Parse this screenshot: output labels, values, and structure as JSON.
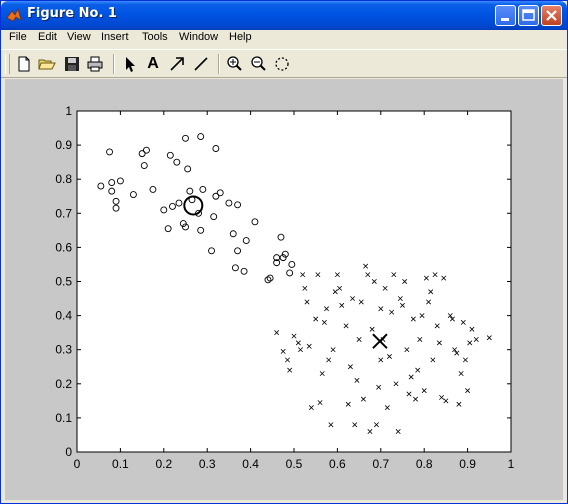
{
  "window": {
    "title": "Figure No. 1",
    "colors": {
      "titlebar": "#0054e3",
      "figure_bg": "#c8c8c8"
    }
  },
  "menu": [
    "File",
    "Edit",
    "View",
    "Insert",
    "Tools",
    "Window",
    "Help"
  ],
  "toolbar": {
    "tools": [
      "new-file-icon",
      "open-folder-icon",
      "save-icon",
      "print-icon",
      "pointer-arrow-icon",
      "text-a-icon",
      "draw-arrow-icon",
      "draw-line-icon",
      "zoom-in-icon",
      "zoom-out-icon",
      "rotate-3d-icon"
    ],
    "text_tool_glyph": "A"
  },
  "chart_data": {
    "type": "scatter",
    "title": "",
    "xlabel": "",
    "ylabel": "",
    "xlim": [
      0,
      1
    ],
    "ylim": [
      0,
      1
    ],
    "xticks": [
      "0",
      "0.1",
      "0.2",
      "0.3",
      "0.4",
      "0.5",
      "0.6",
      "0.7",
      "0.8",
      "0.9",
      "1"
    ],
    "yticks": [
      "0",
      "0.1",
      "0.2",
      "0.3",
      "0.4",
      "0.5",
      "0.6",
      "0.7",
      "0.8",
      "0.9",
      "1"
    ],
    "grid": false,
    "series": [
      {
        "marker": "o",
        "points": [
          [
            0.055,
            0.78
          ],
          [
            0.075,
            0.88
          ],
          [
            0.08,
            0.79
          ],
          [
            0.08,
            0.765
          ],
          [
            0.09,
            0.735
          ],
          [
            0.09,
            0.715
          ],
          [
            0.1,
            0.795
          ],
          [
            0.13,
            0.755
          ],
          [
            0.15,
            0.875
          ],
          [
            0.155,
            0.84
          ],
          [
            0.16,
            0.885
          ],
          [
            0.175,
            0.77
          ],
          [
            0.2,
            0.71
          ],
          [
            0.21,
            0.655
          ],
          [
            0.215,
            0.87
          ],
          [
            0.22,
            0.72
          ],
          [
            0.23,
            0.85
          ],
          [
            0.235,
            0.73
          ],
          [
            0.245,
            0.67
          ],
          [
            0.25,
            0.66
          ],
          [
            0.25,
            0.92
          ],
          [
            0.255,
            0.83
          ],
          [
            0.26,
            0.765
          ],
          [
            0.265,
            0.74
          ],
          [
            0.28,
            0.7
          ],
          [
            0.285,
            0.65
          ],
          [
            0.285,
            0.925
          ],
          [
            0.29,
            0.77
          ],
          [
            0.31,
            0.59
          ],
          [
            0.315,
            0.69
          ],
          [
            0.32,
            0.89
          ],
          [
            0.32,
            0.75
          ],
          [
            0.33,
            0.76
          ],
          [
            0.35,
            0.73
          ],
          [
            0.36,
            0.64
          ],
          [
            0.365,
            0.54
          ],
          [
            0.37,
            0.59
          ],
          [
            0.37,
            0.725
          ],
          [
            0.385,
            0.53
          ],
          [
            0.39,
            0.62
          ],
          [
            0.41,
            0.675
          ],
          [
            0.44,
            0.505
          ],
          [
            0.445,
            0.51
          ],
          [
            0.46,
            0.555
          ],
          [
            0.46,
            0.57
          ],
          [
            0.47,
            0.63
          ],
          [
            0.475,
            0.57
          ],
          [
            0.48,
            0.58
          ],
          [
            0.49,
            0.525
          ],
          [
            0.495,
            0.55
          ]
        ]
      },
      {
        "marker": "x",
        "points": [
          [
            0.46,
            0.35
          ],
          [
            0.475,
            0.295
          ],
          [
            0.485,
            0.27
          ],
          [
            0.49,
            0.24
          ],
          [
            0.5,
            0.34
          ],
          [
            0.51,
            0.32
          ],
          [
            0.515,
            0.3
          ],
          [
            0.52,
            0.52
          ],
          [
            0.525,
            0.48
          ],
          [
            0.53,
            0.44
          ],
          [
            0.535,
            0.31
          ],
          [
            0.54,
            0.13
          ],
          [
            0.55,
            0.39
          ],
          [
            0.555,
            0.52
          ],
          [
            0.56,
            0.145
          ],
          [
            0.565,
            0.23
          ],
          [
            0.57,
            0.38
          ],
          [
            0.575,
            0.42
          ],
          [
            0.58,
            0.27
          ],
          [
            0.585,
            0.08
          ],
          [
            0.59,
            0.3
          ],
          [
            0.595,
            0.47
          ],
          [
            0.6,
            0.52
          ],
          [
            0.605,
            0.48
          ],
          [
            0.61,
            0.43
          ],
          [
            0.62,
            0.37
          ],
          [
            0.625,
            0.14
          ],
          [
            0.63,
            0.25
          ],
          [
            0.635,
            0.45
          ],
          [
            0.64,
            0.08
          ],
          [
            0.645,
            0.21
          ],
          [
            0.65,
            0.33
          ],
          [
            0.655,
            0.44
          ],
          [
            0.66,
            0.155
          ],
          [
            0.665,
            0.545
          ],
          [
            0.67,
            0.52
          ],
          [
            0.675,
            0.06
          ],
          [
            0.68,
            0.36
          ],
          [
            0.685,
            0.5
          ],
          [
            0.69,
            0.08
          ],
          [
            0.695,
            0.19
          ],
          [
            0.7,
            0.42
          ],
          [
            0.7,
            0.27
          ],
          [
            0.705,
            0.33
          ],
          [
            0.71,
            0.48
          ],
          [
            0.715,
            0.13
          ],
          [
            0.72,
            0.28
          ],
          [
            0.725,
            0.41
          ],
          [
            0.73,
            0.52
          ],
          [
            0.735,
            0.2
          ],
          [
            0.74,
            0.06
          ],
          [
            0.745,
            0.45
          ],
          [
            0.75,
            0.43
          ],
          [
            0.755,
            0.5
          ],
          [
            0.76,
            0.3
          ],
          [
            0.765,
            0.17
          ],
          [
            0.77,
            0.22
          ],
          [
            0.775,
            0.39
          ],
          [
            0.78,
            0.155
          ],
          [
            0.785,
            0.24
          ],
          [
            0.79,
            0.33
          ],
          [
            0.795,
            0.4
          ],
          [
            0.8,
            0.18
          ],
          [
            0.805,
            0.51
          ],
          [
            0.81,
            0.44
          ],
          [
            0.815,
            0.47
          ],
          [
            0.82,
            0.27
          ],
          [
            0.825,
            0.52
          ],
          [
            0.83,
            0.37
          ],
          [
            0.835,
            0.32
          ],
          [
            0.84,
            0.16
          ],
          [
            0.845,
            0.51
          ],
          [
            0.85,
            0.15
          ],
          [
            0.86,
            0.4
          ],
          [
            0.865,
            0.39
          ],
          [
            0.87,
            0.3
          ],
          [
            0.875,
            0.29
          ],
          [
            0.88,
            0.14
          ],
          [
            0.885,
            0.23
          ],
          [
            0.89,
            0.38
          ],
          [
            0.895,
            0.27
          ],
          [
            0.9,
            0.18
          ],
          [
            0.905,
            0.32
          ],
          [
            0.91,
            0.36
          ],
          [
            0.92,
            0.33
          ],
          [
            0.95,
            0.335
          ]
        ]
      }
    ],
    "centroids": [
      {
        "marker": "o",
        "x": 0.268,
        "y": 0.723
      },
      {
        "marker": "x",
        "x": 0.698,
        "y": 0.325
      }
    ]
  }
}
